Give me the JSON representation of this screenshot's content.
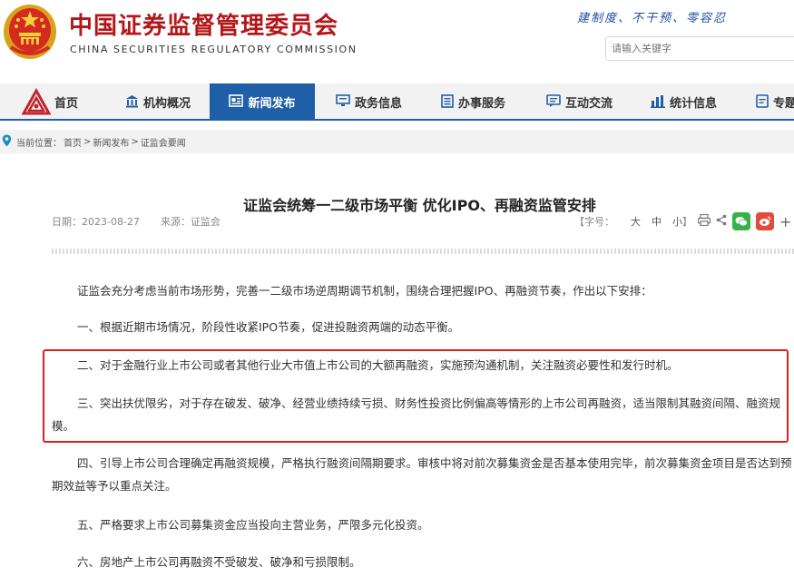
{
  "header": {
    "title": "中国证券监督管理委员会",
    "subtitle": "CHINA SECURITIES REGULATORY COMMISSION",
    "slogan": "建制度、不干预、零容忍",
    "search_placeholder": "请输入关键字"
  },
  "nav": {
    "items": [
      {
        "label": "首页",
        "icon": "home-logo-icon"
      },
      {
        "label": "机构概况",
        "icon": "building-icon"
      },
      {
        "label": "新闻发布",
        "icon": "newspaper-icon",
        "active": true
      },
      {
        "label": "政务信息",
        "icon": "monitor-icon"
      },
      {
        "label": "办事服务",
        "icon": "document-list-icon"
      },
      {
        "label": "互动交流",
        "icon": "chat-icon"
      },
      {
        "label": "统计信息",
        "icon": "bar-chart-icon"
      },
      {
        "label": "专题",
        "icon": "topic-icon"
      }
    ],
    "active_color": "#1f5fa7"
  },
  "breadcrumb": {
    "label": "当前位置：",
    "items": [
      "首页",
      ">",
      "新闻发布",
      ">",
      "证监会要闻"
    ]
  },
  "article": {
    "title": "证监会统筹一二级市场平衡 优化IPO、再融资监管安排",
    "date_label": "日期：",
    "date": "2023-08-27",
    "source_label": "来源：",
    "source": "证监会",
    "font_size_label": "【字号：",
    "font_sizes": [
      "大",
      "中",
      "小"
    ],
    "font_size_end": "】",
    "paragraphs": [
      "证监会充分考虑当前市场形势，完善一二级市场逆周期调节机制，围绕合理把握IPO、再融资节奏，作出以下安排：",
      "一、根据近期市场情况，阶段性收紧IPO节奏，促进投融资两端的动态平衡。",
      "二、对于金融行业上市公司或者其他行业大市值上市公司的大额再融资，实施预沟通机制，关注融资必要性和发行时机。",
      "三、突出扶优限劣，对于存在破发、破净、经营业绩持续亏损、财务性投资比例偏高等情形的上市公司再融资，适当限制其融资间隔、融资规模。",
      "四、引导上市公司合理确定再融资规模，严格执行融资间隔期要求。审核中将对前次募集资金是否基本使用完毕，前次募集资金项目是否达到预期效益等予以重点关注。",
      "五、严格要求上市公司募集资金应当投向主营业务，严限多元化投资。",
      "六、房地产上市公司再融资不受破发、破净和亏损限制。"
    ],
    "highlight_color": "#e02020"
  }
}
